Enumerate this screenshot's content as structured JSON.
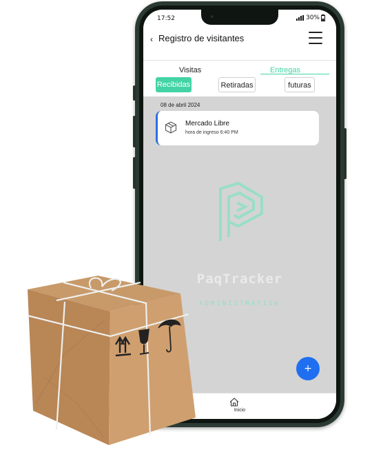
{
  "status": {
    "time": "17:52",
    "battery": "30%"
  },
  "header": {
    "back_glyph": "‹",
    "title": "Registro de visitantes",
    "menu_icon": "hamburger-menu-icon"
  },
  "tabs": [
    {
      "label": "Visitas",
      "active": false
    },
    {
      "label": "Entregas",
      "active": true
    }
  ],
  "filters": [
    {
      "label": "Recibidas",
      "selected": true
    },
    {
      "label": "Retiradas",
      "selected": false
    },
    {
      "label": "futuras",
      "selected": false
    }
  ],
  "list": {
    "date": "08 de abril 2024",
    "items": [
      {
        "name": "Mercado Libre",
        "detail": "hora de ingreso 6:40 PM",
        "icon": "package-icon"
      }
    ]
  },
  "watermark": {
    "brand": "PaqTracker",
    "subtitle": "ADMINISTRATION"
  },
  "fab": {
    "label": "+"
  },
  "bottom_nav": {
    "home_label": "Inicio",
    "icon": "home-icon"
  },
  "colors": {
    "accent": "#43d3a5",
    "card_border": "#2f6de3",
    "fab": "#1f6ff0",
    "background": "#d4d4d4"
  }
}
